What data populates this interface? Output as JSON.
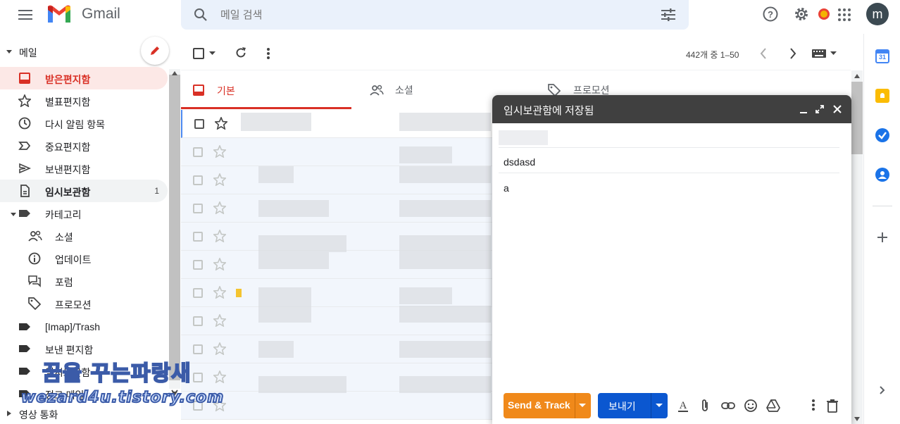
{
  "app": {
    "name": "Gmail",
    "avatar_letter": "m"
  },
  "search": {
    "placeholder": "메일 검색"
  },
  "toolbar": {
    "pagination": "442개 중 1–50"
  },
  "sidebar": {
    "section_label": "메일",
    "items": [
      {
        "label": "받은편지함",
        "count": ""
      },
      {
        "label": "별표편지함",
        "count": ""
      },
      {
        "label": "다시 알림 항목",
        "count": ""
      },
      {
        "label": "중요편지함",
        "count": ""
      },
      {
        "label": "보낸편지함",
        "count": ""
      },
      {
        "label": "임시보관함",
        "count": "1"
      },
      {
        "label": "카테고리",
        "count": ""
      },
      {
        "label": "소셜",
        "count": ""
      },
      {
        "label": "업데이트",
        "count": ""
      },
      {
        "label": "포럼",
        "count": ""
      },
      {
        "label": "프로모션",
        "count": ""
      },
      {
        "label": "[Imap]/Trash",
        "count": ""
      },
      {
        "label": "보낸 편지함",
        "count": ""
      },
      {
        "label": "임시보관함",
        "count": ""
      },
      {
        "label": "정크 메일",
        "count": ""
      }
    ],
    "bottom_label": "영상 통화"
  },
  "tabs": [
    {
      "label": "기본"
    },
    {
      "label": "소셜"
    },
    {
      "label": "프로모션"
    }
  ],
  "compose": {
    "title": "임시보관함에 저장됨",
    "subject": "dsdasd",
    "body": "a",
    "send_track_label": "Send & Track",
    "send_label": "보내기"
  },
  "watermark": {
    "line1": "꿈을 꾸는파랑새",
    "line2": "wezard4u.tistory.com"
  },
  "colors": {
    "accent_red": "#d93025",
    "send_blue": "#0b57d0",
    "track_orange": "#f0891a",
    "compose_header": "#404040"
  }
}
